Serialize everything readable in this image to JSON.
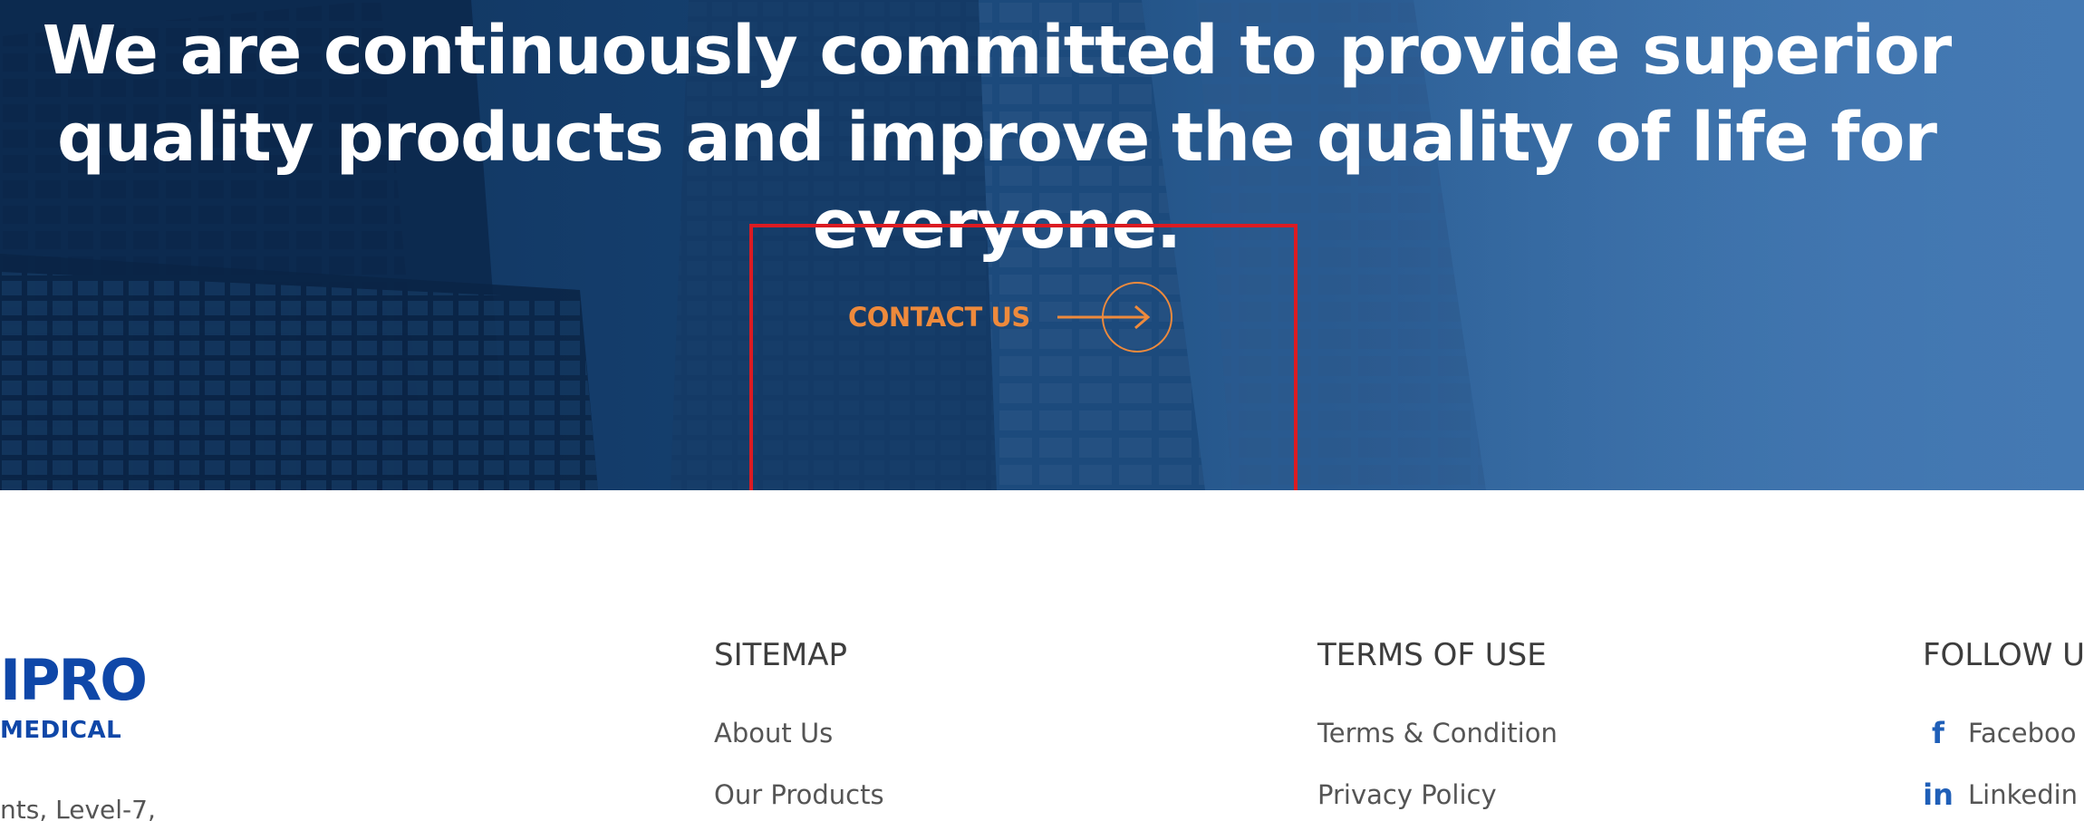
{
  "hero": {
    "title": "We are continuously committed to provide superior quality products and improve the quality of life for everyone.",
    "cta_label": "CONTACT US"
  },
  "footer": {
    "logo_top": "IPRO",
    "logo_bottom": "MEDICAL",
    "address": "nts, Level-7,",
    "sitemap": {
      "heading": "SITEMAP",
      "items": [
        {
          "label": "About Us"
        },
        {
          "label": "Our Products"
        }
      ]
    },
    "terms": {
      "heading": "TERMS OF USE",
      "items": [
        {
          "label": "Terms & Condition"
        },
        {
          "label": "Privacy Policy"
        }
      ]
    },
    "follow": {
      "heading": "FOLLOW U",
      "items": [
        {
          "label": "Faceboo",
          "icon": "facebook-icon"
        },
        {
          "label": "Linkedin",
          "icon": "linkedin-icon"
        }
      ]
    }
  },
  "colors": {
    "accent_orange": "#ee8a3c",
    "brand_blue": "#0f47a8",
    "highlight_red": "#dc1b22",
    "hero_dark": "#0e2f57",
    "hero_light": "#4479b3"
  }
}
